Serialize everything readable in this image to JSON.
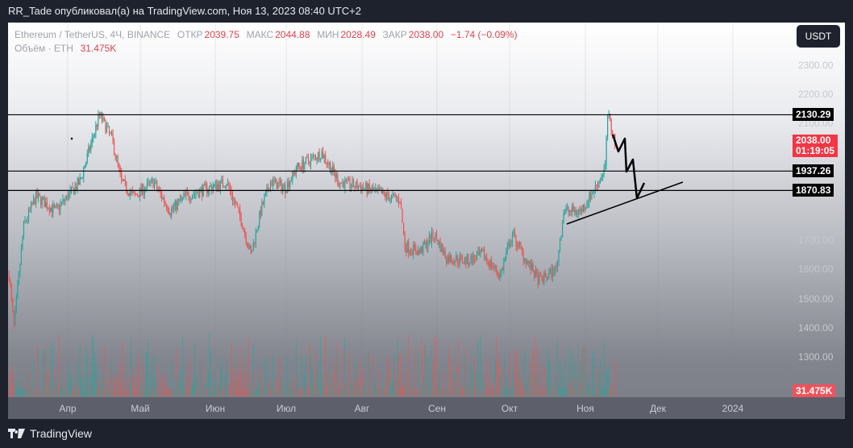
{
  "header": {
    "publisher_line": "RR_Tade опубликовал(а) на TradingView.com, Ноя 13, 2023 08:40 UTC+2"
  },
  "legend": {
    "symbol": "Ethereum / TetherUS, 4Ч, BINANCE",
    "open_label": "ОТКР",
    "open": "2039.75",
    "high_label": "МАКС",
    "high": "2044.88",
    "low_label": "МИН",
    "low": "2028.49",
    "close_label": "ЗАКР",
    "close": "2038.00",
    "change": "−1.74 (−0.09%)",
    "volume_label": "Объём · ETH",
    "volume": "31.475K"
  },
  "currency_button": "USDT",
  "price_labels": [
    "2300.00",
    "2200.00",
    "2100.00",
    "1700.00",
    "1600.00",
    "1500.00",
    "1400.00",
    "1300.00"
  ],
  "levels": [
    {
      "label": "2130.29",
      "price": 2130.29
    },
    {
      "label": "1937.26",
      "price": 1937.26
    },
    {
      "label": "1870.83",
      "price": 1870.83
    }
  ],
  "current_price": {
    "price": "2038.00",
    "countdown": "01:19:05"
  },
  "volume_tag": "31.475K",
  "time_labels": [
    "Апр",
    "Май",
    "Июн",
    "Июл",
    "Авг",
    "Сен",
    "Окт",
    "Ноя",
    "Дек",
    "2024"
  ],
  "brand": "TradingView",
  "colors": {
    "up": "#26a69a",
    "down": "#ef5350",
    "current": "#f23645"
  },
  "chart_data": {
    "type": "candlestick",
    "x_unit": "days since 2023-04-01",
    "price_path": [
      [
        -24,
        1580
      ],
      [
        -22,
        1400
      ],
      [
        -18,
        1750
      ],
      [
        -13,
        1850
      ],
      [
        -5,
        1800
      ],
      [
        5,
        1900
      ],
      [
        13,
        2130
      ],
      [
        18,
        2050
      ],
      [
        22,
        1900
      ],
      [
        27,
        1850
      ],
      [
        35,
        1900
      ],
      [
        42,
        1800
      ],
      [
        48,
        1850
      ],
      [
        58,
        1880
      ],
      [
        65,
        1900
      ],
      [
        71,
        1770
      ],
      [
        75,
        1650
      ],
      [
        79,
        1800
      ],
      [
        83,
        1900
      ],
      [
        89,
        1880
      ],
      [
        94,
        1950
      ],
      [
        104,
        2000
      ],
      [
        111,
        1900
      ],
      [
        121,
        1880
      ],
      [
        131,
        1850
      ],
      [
        136,
        1840
      ],
      [
        138,
        1680
      ],
      [
        144,
        1660
      ],
      [
        150,
        1720
      ],
      [
        155,
        1640
      ],
      [
        164,
        1630
      ],
      [
        170,
        1650
      ],
      [
        177,
        1580
      ],
      [
        182,
        1720
      ],
      [
        187,
        1640
      ],
      [
        193,
        1560
      ],
      [
        200,
        1600
      ],
      [
        203,
        1800
      ],
      [
        210,
        1800
      ],
      [
        216,
        1880
      ],
      [
        220,
        1950
      ],
      [
        221,
        2130
      ],
      [
        224,
        2038
      ]
    ],
    "ylim": [
      1200,
      2350
    ]
  }
}
